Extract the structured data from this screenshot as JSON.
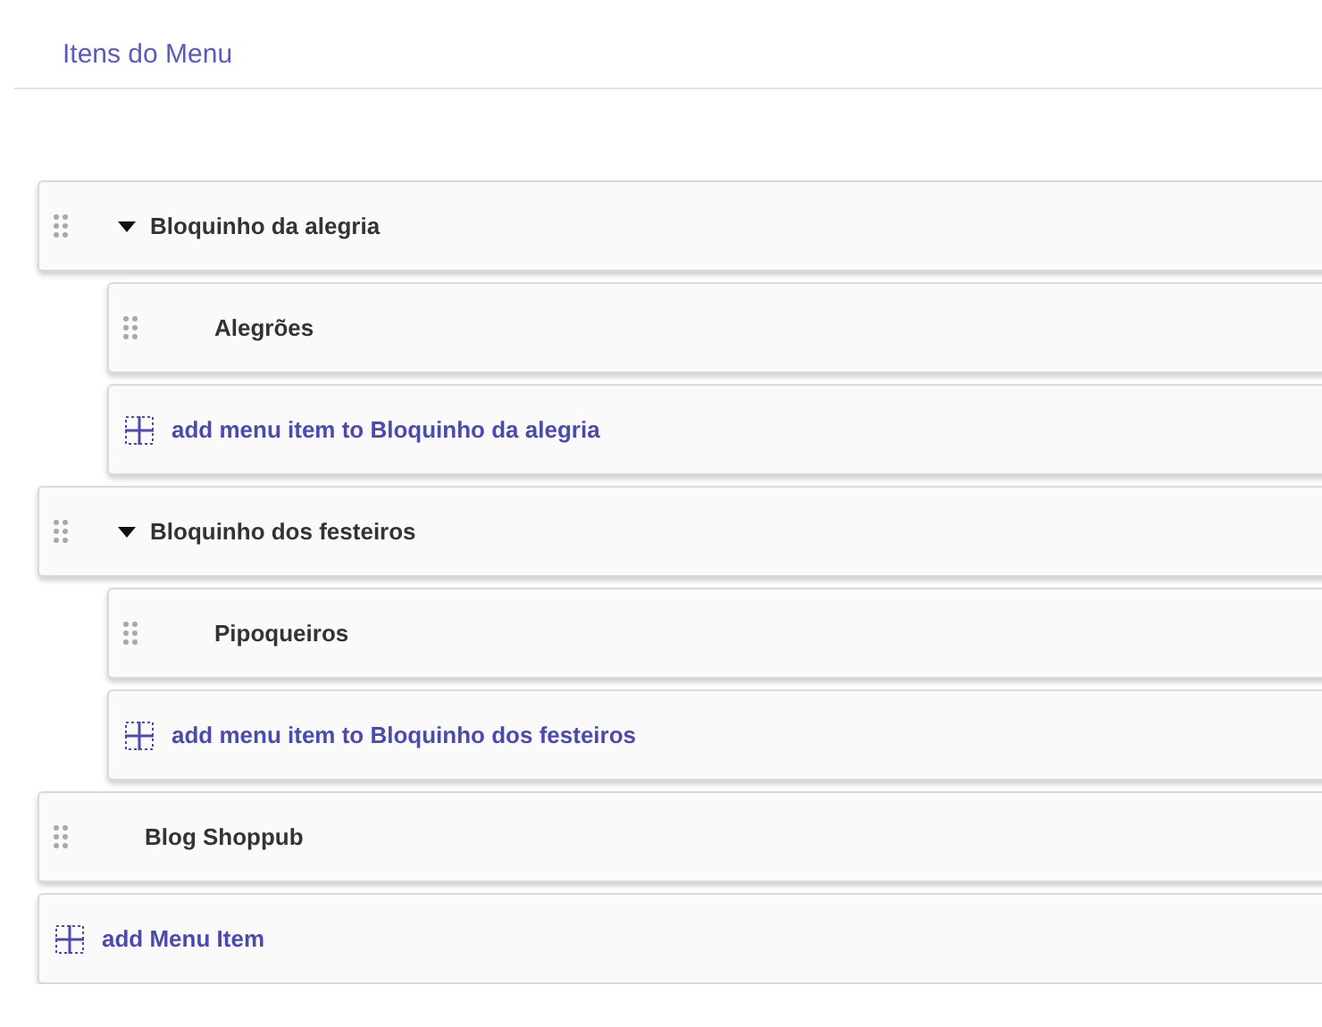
{
  "title": "Itens do Menu",
  "items": [
    {
      "kind": "group",
      "label": "Bloquinho da alegria",
      "expanded": true,
      "children": [
        {
          "label": "Alegrões"
        }
      ],
      "add_label": "add menu item to Bloquinho da alegria"
    },
    {
      "kind": "group",
      "label": "Bloquinho dos festeiros",
      "expanded": true,
      "children": [
        {
          "label": "Pipoqueiros"
        }
      ],
      "add_label": "add menu item to Bloquinho dos festeiros"
    },
    {
      "kind": "link",
      "label": "Blog Shoppub"
    }
  ],
  "add_label": "add Menu Item"
}
